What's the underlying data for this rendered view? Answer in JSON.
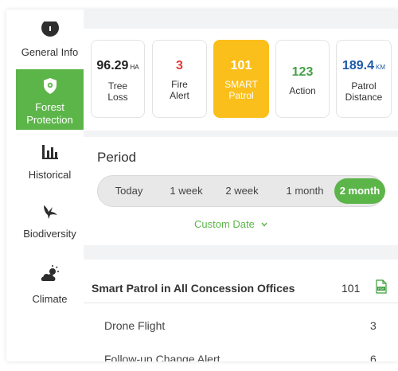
{
  "sidebar": {
    "items": [
      {
        "label": "General Info",
        "icon": "info-icon"
      },
      {
        "label": "Forest Protection",
        "label_line1": "Forest",
        "label_line2": "Protection",
        "icon": "shield-icon"
      },
      {
        "label": "Historical",
        "icon": "bar-chart-icon"
      },
      {
        "label": "Biodiversity",
        "icon": "bird-icon"
      },
      {
        "label": "Climate",
        "icon": "cloud-sun-icon"
      }
    ]
  },
  "stats": [
    {
      "value": "96.29",
      "unit": "HA",
      "label_line1": "Tree",
      "label_line2": "Loss",
      "color": "#222222"
    },
    {
      "value": "3",
      "unit": "",
      "label_line1": "Fire",
      "label_line2": "Alert",
      "color": "#e53935"
    },
    {
      "value": "101",
      "unit": "",
      "label_line1": "SMART",
      "label_line2": "Patrol",
      "color": "#ffffff"
    },
    {
      "value": "123",
      "unit": "",
      "label_line1": "Action",
      "label_line2": "",
      "color": "#43a047"
    },
    {
      "value": "189.4",
      "unit": "KM",
      "label_line1": "Patrol",
      "label_line2": "Distance",
      "color": "#1e5aa8"
    }
  ],
  "period": {
    "title": "Period",
    "options": [
      "Today",
      "1 week",
      "2 week",
      "1 month",
      "2 month"
    ],
    "selected": "2 month",
    "custom_date_label": "Custom Date"
  },
  "patrol": {
    "title": "Smart Patrol in All Concession Offices",
    "total": "101",
    "pdf_label": "PDF",
    "rows": [
      {
        "label": "Drone Flight",
        "value": "3"
      },
      {
        "label": "Follow-up Change Alert",
        "value": "6"
      }
    ]
  },
  "colors": {
    "accent_green": "#5cb549",
    "smart_yellow": "#fbbf1c"
  }
}
